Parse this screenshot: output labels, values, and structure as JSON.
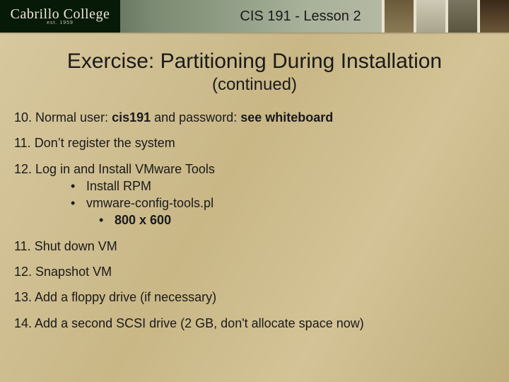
{
  "banner": {
    "logo_top": "Cabrillo College",
    "logo_sub": "est. 1959",
    "lesson": "CIS 191 - Lesson 2"
  },
  "title": "Exercise: Partitioning During Installation",
  "subtitle": "(continued)",
  "bullet_char": "•",
  "items": {
    "i10": {
      "num": "10.",
      "pre": " Normal user: ",
      "b1": "cis191",
      "mid": " and password: ",
      "b2": "see whiteboard"
    },
    "i11a": {
      "num": "11.",
      "text": " Don’t register the system"
    },
    "i12a": {
      "num": "12.",
      "text": " Log in and Install VMware Tools",
      "sub": {
        "s1": "Install RPM",
        "s2": "vmware-config-tools.pl",
        "s3": "800 x 600"
      }
    },
    "i11b": {
      "num": "11.",
      "text": " Shut down VM"
    },
    "i12b": {
      "num": "12.",
      "text": " Snapshot VM"
    },
    "i13": {
      "num": "13.",
      "text": " Add a floppy drive (if necessary)"
    },
    "i14": {
      "num": "14.",
      "text": " Add a second SCSI drive (2 GB, don't allocate space now)"
    }
  }
}
